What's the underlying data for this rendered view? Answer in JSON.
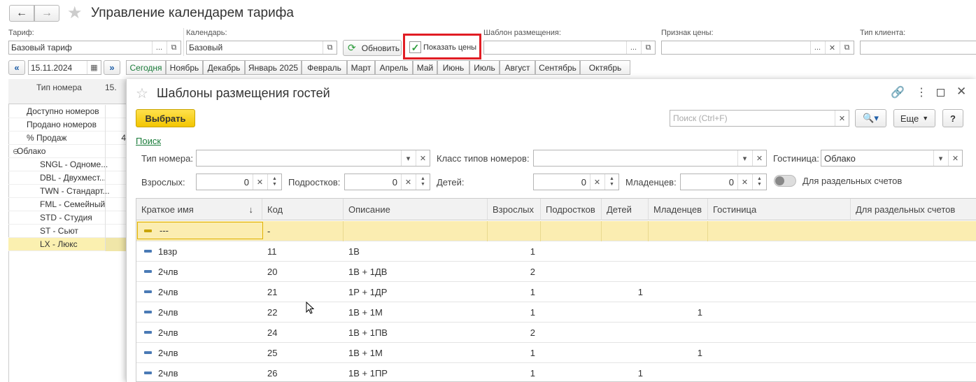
{
  "window": {
    "title": "Управление календарем тарифа"
  },
  "filters": {
    "tariff_label": "Тариф:",
    "tariff_value": "Базовый тариф",
    "calendar_label": "Календарь:",
    "calendar_value": "Базовый",
    "refresh_label": "Обновить",
    "show_prices_label": "Показать цены",
    "template_label": "Шаблон размещения:",
    "price_sign_label": "Признак цены:",
    "client_type_label": "Тип клиента:"
  },
  "dates": {
    "date_value": "15.11.2024",
    "months": [
      "Сегодня",
      "Ноябрь",
      "Декабрь",
      "Январь 2025",
      "Февраль",
      "Март",
      "Апрель",
      "Май",
      "Июнь",
      "Июль",
      "Август",
      "Сентябрь",
      "Октябрь"
    ]
  },
  "left_panel": {
    "header": "Тип номера",
    "col2_header": "15.",
    "rows": [
      {
        "label": "Доступно номеров",
        "value": ""
      },
      {
        "label": "Продано номеров",
        "value": ""
      },
      {
        "label": "% Продаж",
        "value": "4"
      },
      {
        "label": "Облако",
        "value": ""
      },
      {
        "label": "SNGL - Одноме...",
        "value": ""
      },
      {
        "label": "DBL - Двухмест...",
        "value": ""
      },
      {
        "label": "TWN - Стандарт...",
        "value": ""
      },
      {
        "label": "FML - Семейный",
        "value": ""
      },
      {
        "label": "STD - Студия",
        "value": ""
      },
      {
        "label": "ST - Сьют",
        "value": ""
      },
      {
        "label": "LX - Люкс",
        "value": ""
      }
    ]
  },
  "dialog": {
    "title": "Шаблоны размещения гостей",
    "select_button": "Выбрать",
    "search_placeholder": "Поиск (Ctrl+F)",
    "more_button": "Еще",
    "help_button": "?",
    "search_link": "Поиск",
    "room_type_label": "Тип номера:",
    "room_class_label": "Класс типов номеров:",
    "hotel_label": "Гостиница:",
    "hotel_value": "Облако",
    "adults_label": "Взрослых:",
    "adults_value": "0",
    "teens_label": "Подростков:",
    "teens_value": "0",
    "children_label": "Детей:",
    "children_value": "0",
    "infants_label": "Младенцев:",
    "infants_value": "0",
    "separate_label": "Для раздельных счетов",
    "columns": [
      "Краткое имя",
      "Код",
      "Описание",
      "Взрослых",
      "Подростков",
      "Детей",
      "Младенцев",
      "Гостиница",
      "Для раздельных счетов"
    ],
    "rows": [
      {
        "name": "---",
        "code": "-",
        "desc": "",
        "adults": "",
        "teens": "",
        "children": "",
        "infants": ""
      },
      {
        "name": "1взр",
        "code": "11",
        "desc": "1В",
        "adults": "1",
        "teens": "",
        "children": "",
        "infants": ""
      },
      {
        "name": "2члв",
        "code": "20",
        "desc": "1В + 1ДВ",
        "adults": "2",
        "teens": "",
        "children": "",
        "infants": ""
      },
      {
        "name": "2члв",
        "code": "21",
        "desc": "1Р + 1ДР",
        "adults": "1",
        "teens": "",
        "children": "1",
        "infants": ""
      },
      {
        "name": "2члв",
        "code": "22",
        "desc": "1В + 1М",
        "adults": "1",
        "teens": "",
        "children": "",
        "infants": "1"
      },
      {
        "name": "2члв",
        "code": "24",
        "desc": "1В + 1ПВ",
        "adults": "2",
        "teens": "",
        "children": "",
        "infants": ""
      },
      {
        "name": "2члв",
        "code": "25",
        "desc": "1В + 1М",
        "adults": "1",
        "teens": "",
        "children": "",
        "infants": "1"
      },
      {
        "name": "2члв",
        "code": "26",
        "desc": "1В + 1ПР",
        "adults": "1",
        "teens": "",
        "children": "1",
        "infants": ""
      }
    ]
  }
}
